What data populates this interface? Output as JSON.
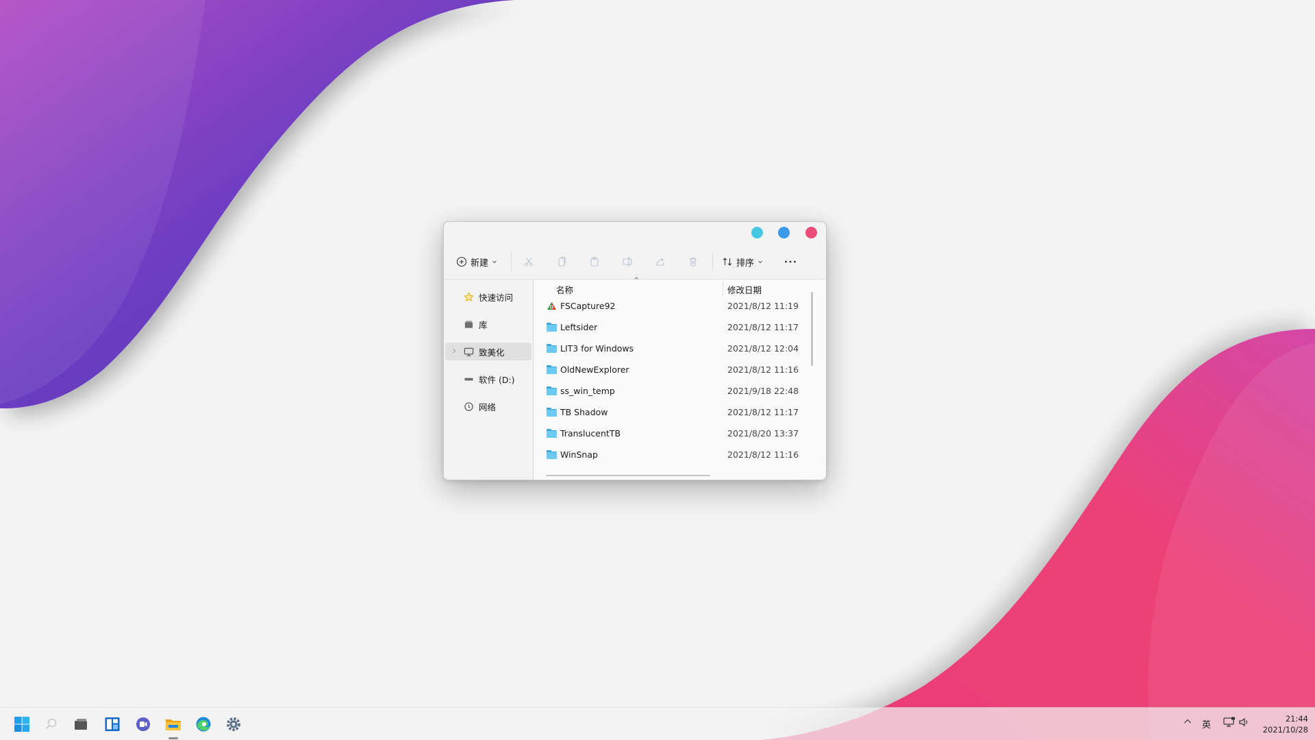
{
  "window": {
    "toolbar": {
      "new_label": "新建",
      "sort_label": "排序"
    },
    "nav": {
      "items": [
        {
          "label": "快速访问",
          "icon": "star-icon"
        },
        {
          "label": "库",
          "icon": "library-icon"
        },
        {
          "label": "致美化",
          "icon": "computer-icon",
          "selected": true
        },
        {
          "label": "软件 (D:)",
          "icon": "drive-icon"
        },
        {
          "label": "网络",
          "icon": "network-icon"
        }
      ]
    },
    "columns": {
      "name": "名称",
      "date": "修改日期"
    },
    "files": [
      {
        "name": "FSCapture92",
        "date": "2021/8/12 11:19",
        "icon": "app-icon"
      },
      {
        "name": "Leftsider",
        "date": "2021/8/12 11:17",
        "icon": "folder-icon"
      },
      {
        "name": "LIT3 for Windows",
        "date": "2021/8/12 12:04",
        "icon": "folder-icon"
      },
      {
        "name": "OldNewExplorer",
        "date": "2021/8/12 11:16",
        "icon": "folder-icon"
      },
      {
        "name": "ss_win_temp",
        "date": "2021/9/18 22:48",
        "icon": "folder-icon"
      },
      {
        "name": "TB Shadow",
        "date": "2021/8/12 11:17",
        "icon": "folder-icon"
      },
      {
        "name": "TranslucentTB",
        "date": "2021/8/20 13:37",
        "icon": "folder-icon"
      },
      {
        "name": "WinSnap",
        "date": "2021/8/12 11:16",
        "icon": "folder-icon"
      }
    ]
  },
  "taskbar": {
    "tray": {
      "ime": "英"
    },
    "clock": {
      "time": "21:44",
      "date": "2021/10/28"
    }
  },
  "colors": {
    "wallpaper_purple": "#6a3fc0",
    "wallpaper_pink": "#ee4079",
    "close_button": "#ec4c77",
    "max_button": "#3a9bea",
    "min_button": "#46c8e3"
  }
}
